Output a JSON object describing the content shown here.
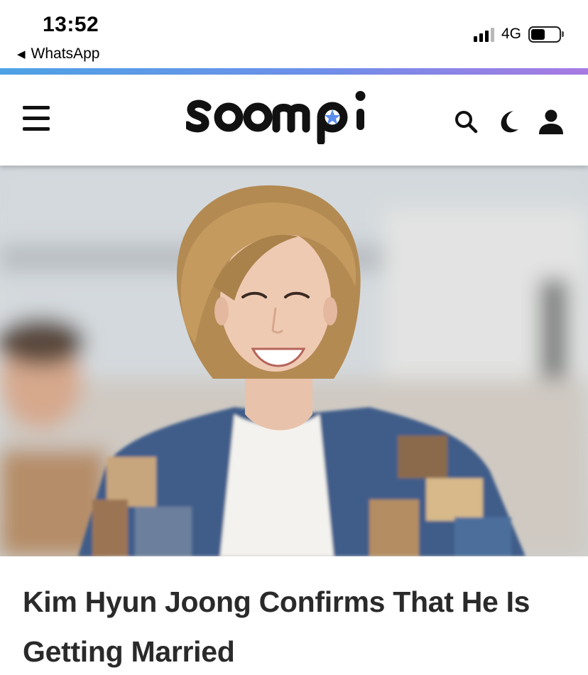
{
  "status_bar": {
    "time": "13:52",
    "back_app": "WhatsApp",
    "network": "4G",
    "battery_level": 0.5
  },
  "header": {
    "brand": "soompi",
    "accent_gradient": [
      "#4ea3e6",
      "#a97ae3"
    ],
    "star_color": "#5b8def",
    "icons": [
      "menu-icon",
      "search-icon",
      "moon-icon",
      "user-icon"
    ]
  },
  "article": {
    "headline": "Kim Hyun Joong Confirms That He Is Getting Married"
  }
}
